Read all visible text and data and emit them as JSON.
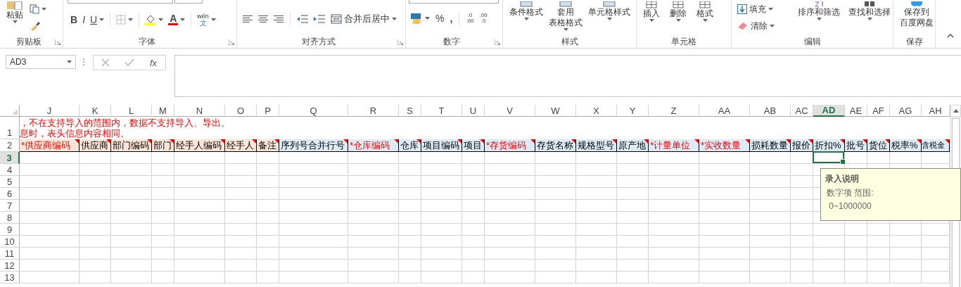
{
  "ribbon": {
    "clipboard": {
      "label": "剪贴板",
      "paste": "粘贴"
    },
    "font": {
      "label": "字体",
      "bold": "B",
      "italic": "I",
      "underline": "U",
      "font_color": "A",
      "phonetic_top": "wén",
      "phonetic_bottom": "文"
    },
    "alignment": {
      "label": "对齐方式",
      "merge": "合并后居中"
    },
    "number": {
      "label": "数字",
      "percent": "%",
      "comma": ",",
      "decimals": [
        {
          "top": ".0",
          "bottom": ".00"
        },
        {
          "top": ".00",
          "bottom": ".0"
        }
      ]
    },
    "styles": {
      "label": "样式",
      "buttons": [
        {
          "lines": [
            "条件格式"
          ]
        },
        {
          "lines": [
            "套用",
            "表格格式"
          ]
        },
        {
          "lines": [
            "单元格样式"
          ]
        }
      ]
    },
    "cells": {
      "label": "单元格",
      "buttons": [
        "插入",
        "删除",
        "格式"
      ]
    },
    "editing": {
      "label": "编辑",
      "fill": "填充",
      "clear": "清除",
      "sort": "排序和筛选",
      "find": "查找和选择"
    },
    "save": {
      "label": "保存",
      "lines": [
        "保存到",
        "百度网盘"
      ]
    }
  },
  "formula_bar": {
    "name_box": "AD3",
    "fx": "fx"
  },
  "columns": [
    {
      "letter": "J",
      "selected": false
    },
    {
      "letter": "K",
      "selected": false
    },
    {
      "letter": "L",
      "selected": false
    },
    {
      "letter": "M",
      "selected": false
    },
    {
      "letter": "N",
      "selected": false
    },
    {
      "letter": "O",
      "selected": false
    },
    {
      "letter": "P",
      "selected": false
    },
    {
      "letter": "Q",
      "selected": false
    },
    {
      "letter": "R",
      "selected": false
    },
    {
      "letter": "S",
      "selected": false
    },
    {
      "letter": "T",
      "selected": false
    },
    {
      "letter": "U",
      "selected": false
    },
    {
      "letter": "V",
      "selected": false
    },
    {
      "letter": "W",
      "selected": false
    },
    {
      "letter": "X",
      "selected": false
    },
    {
      "letter": "Y",
      "selected": false
    },
    {
      "letter": "Z",
      "selected": false
    },
    {
      "letter": "AA",
      "selected": false
    },
    {
      "letter": "AB",
      "selected": false
    },
    {
      "letter": "AC",
      "selected": false
    },
    {
      "letter": "AD",
      "selected": true
    },
    {
      "letter": "AE",
      "selected": false
    },
    {
      "letter": "AF",
      "selected": false
    },
    {
      "letter": "AG",
      "selected": false
    },
    {
      "letter": "AH",
      "selected": false
    }
  ],
  "rows": [
    {
      "number": "1",
      "selected": false
    },
    {
      "number": "2",
      "selected": false
    },
    {
      "number": "3",
      "selected": true
    },
    {
      "number": "4",
      "selected": false
    },
    {
      "number": "5",
      "selected": false
    },
    {
      "number": "6",
      "selected": false
    },
    {
      "number": "7",
      "selected": false
    },
    {
      "number": "8",
      "selected": false
    },
    {
      "number": "9",
      "selected": false
    },
    {
      "number": "10",
      "selected": false
    },
    {
      "number": "11",
      "selected": false
    },
    {
      "number": "12",
      "selected": false
    },
    {
      "number": "13",
      "selected": false
    }
  ],
  "notes": [
    "，不在支持导入的范围内，数据不支持导入、导出。",
    "息时，表头信息内容相同。"
  ],
  "field_headers": [
    {
      "text": "*供应商编码",
      "required": true,
      "color": "#fce4d6"
    },
    {
      "text": "供应商",
      "required": false,
      "color": "#fce4d6"
    },
    {
      "text": "部门编码",
      "required": false,
      "color": "#fce4d6"
    },
    {
      "text": "部门",
      "required": false,
      "color": "#fce4d6"
    },
    {
      "text": "经手人编码",
      "required": false,
      "color": "#fce4d6"
    },
    {
      "text": "经手人",
      "required": false,
      "color": "#fce4d6"
    },
    {
      "text": "备注",
      "required": false,
      "color": "#fce4d6"
    },
    {
      "text": "序列号合并行号",
      "required": false,
      "color": "#ddebf7"
    },
    {
      "text": "*仓库编码",
      "required": true,
      "color": "#ddebf7"
    },
    {
      "text": "仓库",
      "required": false,
      "color": "#ddebf7"
    },
    {
      "text": "项目编码",
      "required": false,
      "color": "#ddebf7"
    },
    {
      "text": "项目",
      "required": false,
      "color": "#ddebf7"
    },
    {
      "text": "*存货编码",
      "required": true,
      "color": "#ddebf7"
    },
    {
      "text": "存货名称",
      "required": false,
      "color": "#ddebf7"
    },
    {
      "text": "规格型号",
      "required": false,
      "color": "#ddebf7"
    },
    {
      "text": "原产地",
      "required": false,
      "color": "#ddebf7"
    },
    {
      "text": "*计量单位",
      "required": true,
      "color": "#ddebf7"
    },
    {
      "text": "*实收数量",
      "required": true,
      "color": "#ddebf7"
    },
    {
      "text": "损耗数量",
      "required": false,
      "color": "#ddebf7"
    },
    {
      "text": "报价",
      "required": false,
      "color": "#ddebf7"
    },
    {
      "text": "折扣%",
      "required": false,
      "color": "#ddebf7"
    },
    {
      "text": "批号",
      "required": false,
      "color": "#ddebf7"
    },
    {
      "text": "货位",
      "required": false,
      "color": "#ddebf7"
    },
    {
      "text": "税率%",
      "required": false,
      "color": "#ddebf7"
    },
    {
      "text": "含税金",
      "required": false,
      "color": "#ddebf7"
    }
  ],
  "tooltip": {
    "title": "录入说明",
    "lines": [
      "数字项 范围:",
      " 0~1000000"
    ]
  }
}
